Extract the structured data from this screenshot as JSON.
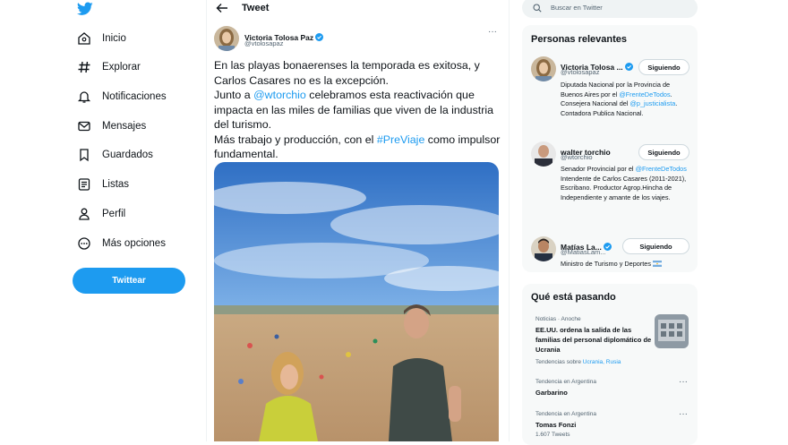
{
  "nav": {
    "items": [
      {
        "label": "Inicio",
        "icon": "home-icon"
      },
      {
        "label": "Explorar",
        "icon": "hashtag-icon"
      },
      {
        "label": "Notificaciones",
        "icon": "bell-icon"
      },
      {
        "label": "Mensajes",
        "icon": "envelope-icon"
      },
      {
        "label": "Guardados",
        "icon": "bookmark-icon"
      },
      {
        "label": "Listas",
        "icon": "list-icon"
      },
      {
        "label": "Perfil",
        "icon": "person-icon"
      },
      {
        "label": "Más opciones",
        "icon": "more-circle-icon"
      }
    ],
    "tweet_button": "Twittear"
  },
  "header": {
    "title": "Tweet"
  },
  "tweet": {
    "author_name": "Victoria Tolosa Paz",
    "author_handle": "@vtolosapaz",
    "text": {
      "line1": "En las playas bonaerenses la temporada es exitosa, y Carlos Casares no es la excepción.",
      "line2_pre": "Junto a ",
      "mention": "@wtorchio",
      "line2_post": " celebramos esta reactivación que impacta en las miles de familias que viven de la industria del turismo.",
      "line3_pre": "Más trabajo y producción, con el ",
      "hashtag": "#PreViaje",
      "line3_post": " como impulsor fundamental."
    },
    "more": "···"
  },
  "search": {
    "placeholder": "Buscar en Twitter"
  },
  "relevant": {
    "title": "Personas relevantes",
    "people": [
      {
        "name": "Victoria Tolosa ...",
        "handle": "@vtolosapaz",
        "button": "Siguiendo",
        "bio_a": "Diputada Nacional por la Provincia de Buenos Aires por el ",
        "bio_link1": "@FrenteDeTodos",
        "bio_b": ". Consejera Nacional del ",
        "bio_link2": "@p_justicialista",
        "bio_c": ". Contadora Publica Nacional."
      },
      {
        "name": "walter torchio",
        "handle": "@wtorchio",
        "button": "Siguiendo",
        "bio_a": "Senador Provincial por el ",
        "bio_link1": "@FrenteDeTodos",
        "bio_b": " Intendente de Carlos Casares (2011-2021), Escribano. Productor Agrop.Hincha de Independiente y amante de los viajes."
      },
      {
        "name": "Matías La...",
        "handle": "@MatiasLam...",
        "button": "Siguiendo",
        "bio_a": "Ministro de Turismo y Deportes "
      }
    ]
  },
  "trends": {
    "title": "Qué está pasando",
    "items": [
      {
        "meta": "Noticias · Anoche",
        "title": "EE.UU. ordena la salida de las familias del personal diplomático de Ucrania",
        "sub_pre": "Tendencias sobre ",
        "sub_links": "Ucrania, Rusia"
      },
      {
        "meta": "Tendencia en Argentina",
        "title": "Garbarino",
        "more": "···"
      },
      {
        "meta": "Tendencia en Argentina",
        "title": "Tomas Fonzi",
        "count": "1.607 Tweets",
        "more": "···"
      }
    ]
  },
  "colors": {
    "accent": "#1d9bf0",
    "text": "#0f1419",
    "muted": "#536471",
    "panel": "#f7f9f9"
  }
}
